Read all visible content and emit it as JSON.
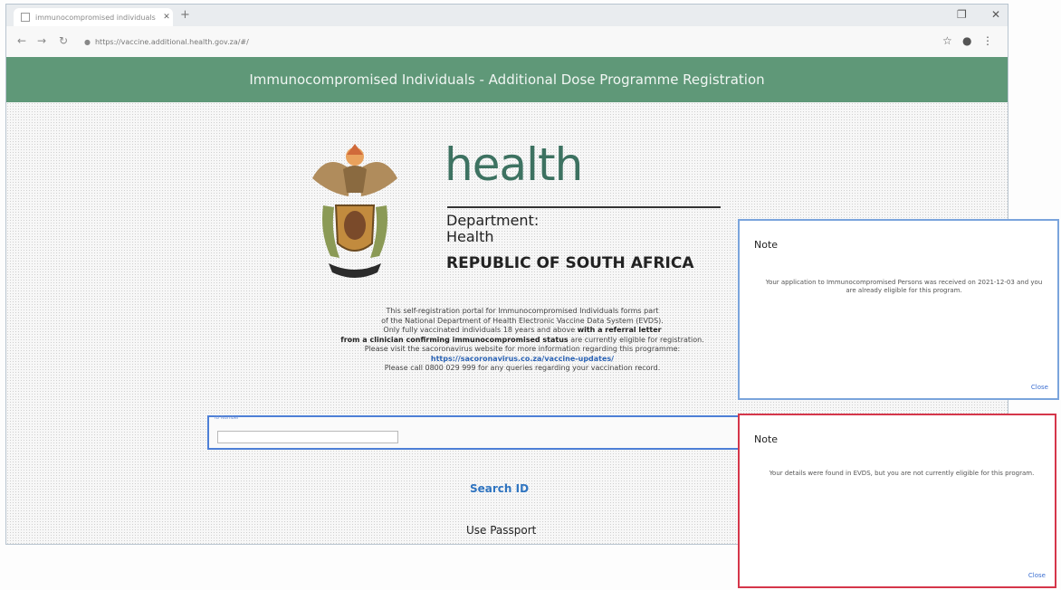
{
  "browser": {
    "tab_title": "immunocompromised individuals",
    "url": "https://vaccine.additional.health.gov.za/#/"
  },
  "banner": {
    "title": "Immunocompromised Individuals - Additional Dose Programme Registration"
  },
  "logo": {
    "word": "health",
    "line1": "Department:",
    "line2": "Health",
    "line3": "REPUBLIC OF SOUTH AFRICA"
  },
  "description": {
    "line1": "This self-registration portal for Immunocompromised Individuals forms part",
    "line2": "of the National Department of Health Electronic Vaccine Data System (EVDS).",
    "line3_plain": "Only fully vaccinated individuals 18 years and above ",
    "line3_bold": "with a referral letter",
    "line4_bold": "from a clinician confirming immunocompromised status",
    "line4_plain": " are currently eligible for registration.",
    "line5": "Please visit the sacoronavirus website for more information regarding this programme:",
    "link": "https://sacoronavirus.co.za/vaccine-updates/",
    "line6": "Please call 0800 029 999 for any queries regarding your vaccination record."
  },
  "form": {
    "id_label": "ID Number",
    "id_value": "",
    "search_button": "Search ID",
    "passport_button": "Use Passport"
  },
  "dialog_upper": {
    "title": "Note",
    "message": "Your application to Immunocompromised Persons was received on 2021-12-03 and you are already eligible for this program.",
    "close": "Close"
  },
  "dialog_lower": {
    "title": "Note",
    "message": "Your details were found in EVDS, but you are not currently eligible for this program.",
    "close": "Close"
  },
  "colors": {
    "banner": "#5f9878",
    "upper_dialog_border": "#7aa4dc",
    "lower_dialog_border": "#d5364a",
    "link": "#2b63b5"
  }
}
